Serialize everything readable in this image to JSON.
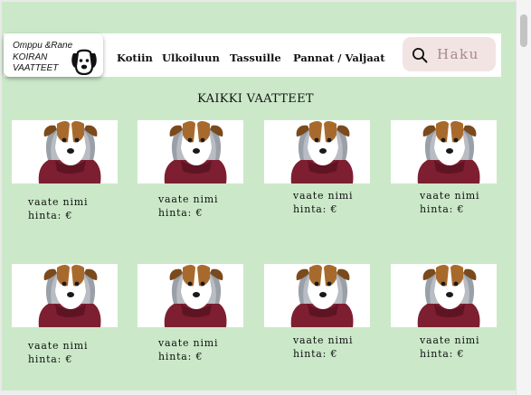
{
  "brand": {
    "line1": "Omppu &Rane",
    "line2": "KOIRAN",
    "line3": "VAATTEET",
    "icon": "dog-face-icon"
  },
  "nav": {
    "items": [
      {
        "label": "Kotiin"
      },
      {
        "label": "Ulkoiluun"
      },
      {
        "label": "Tassuille"
      },
      {
        "label": "Pannat / Valjaat"
      }
    ]
  },
  "search": {
    "placeholder": "Haku",
    "icon": "search-icon",
    "background": "#f3e4e4"
  },
  "page": {
    "heading": "KAIKKI VAATTEET",
    "background": "#cbe9c9"
  },
  "products": [
    {
      "name": "vaate nimi",
      "price": "hinta: €",
      "image": "dog-in-red-hoodie"
    },
    {
      "name": "vaate nimi",
      "price": "hinta: €",
      "image": "dog-in-red-hoodie"
    },
    {
      "name": "vaate nimi",
      "price": "hinta: €",
      "image": "dog-in-red-hoodie"
    },
    {
      "name": "vaate nimi",
      "price": "hinta: €",
      "image": "dog-in-red-hoodie"
    },
    {
      "name": "vaate nimi",
      "price": "hinta: €",
      "image": "dog-in-red-hoodie"
    },
    {
      "name": "vaate nimi",
      "price": "hinta: €",
      "image": "dog-in-red-hoodie"
    },
    {
      "name": "vaate nimi",
      "price": "hinta: €",
      "image": "dog-in-red-hoodie"
    },
    {
      "name": "vaate nimi",
      "price": "hinta: €",
      "image": "dog-in-red-hoodie"
    }
  ]
}
